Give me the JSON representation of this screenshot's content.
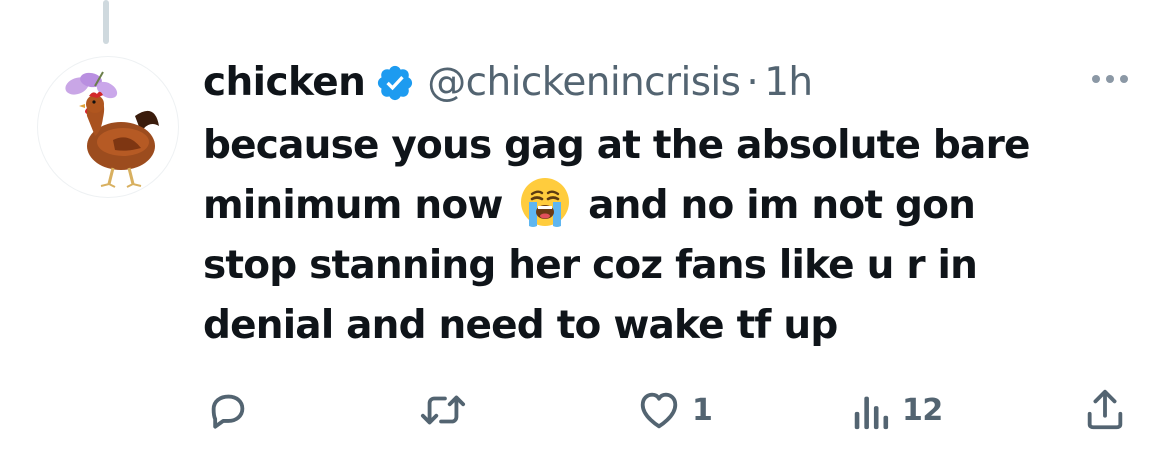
{
  "tweet": {
    "author": {
      "display_name": "chicken",
      "handle": "@chickenincrisis",
      "verified": true,
      "avatar_icon": "chicken-avatar"
    },
    "separator": "·",
    "timestamp": "1h",
    "text_lines": [
      "because yous gag at the absolute bare",
      "minimum now",
      "and no im not gon",
      "stop stanning her coz fans like u r in",
      "denial and need to wake tf up"
    ],
    "emoji": "loudly-crying-face"
  },
  "actions": {
    "reply": {
      "icon": "reply-icon",
      "count": ""
    },
    "retweet": {
      "icon": "retweet-icon",
      "count": ""
    },
    "like": {
      "icon": "heart-icon",
      "count": "1"
    },
    "views": {
      "icon": "views-icon",
      "count": "12"
    },
    "share": {
      "icon": "share-icon",
      "count": ""
    }
  },
  "colors": {
    "text_primary": "#0f1419",
    "text_secondary": "#536471",
    "verified_blue": "#1d9bf0",
    "thread_line": "#cfd9de"
  }
}
